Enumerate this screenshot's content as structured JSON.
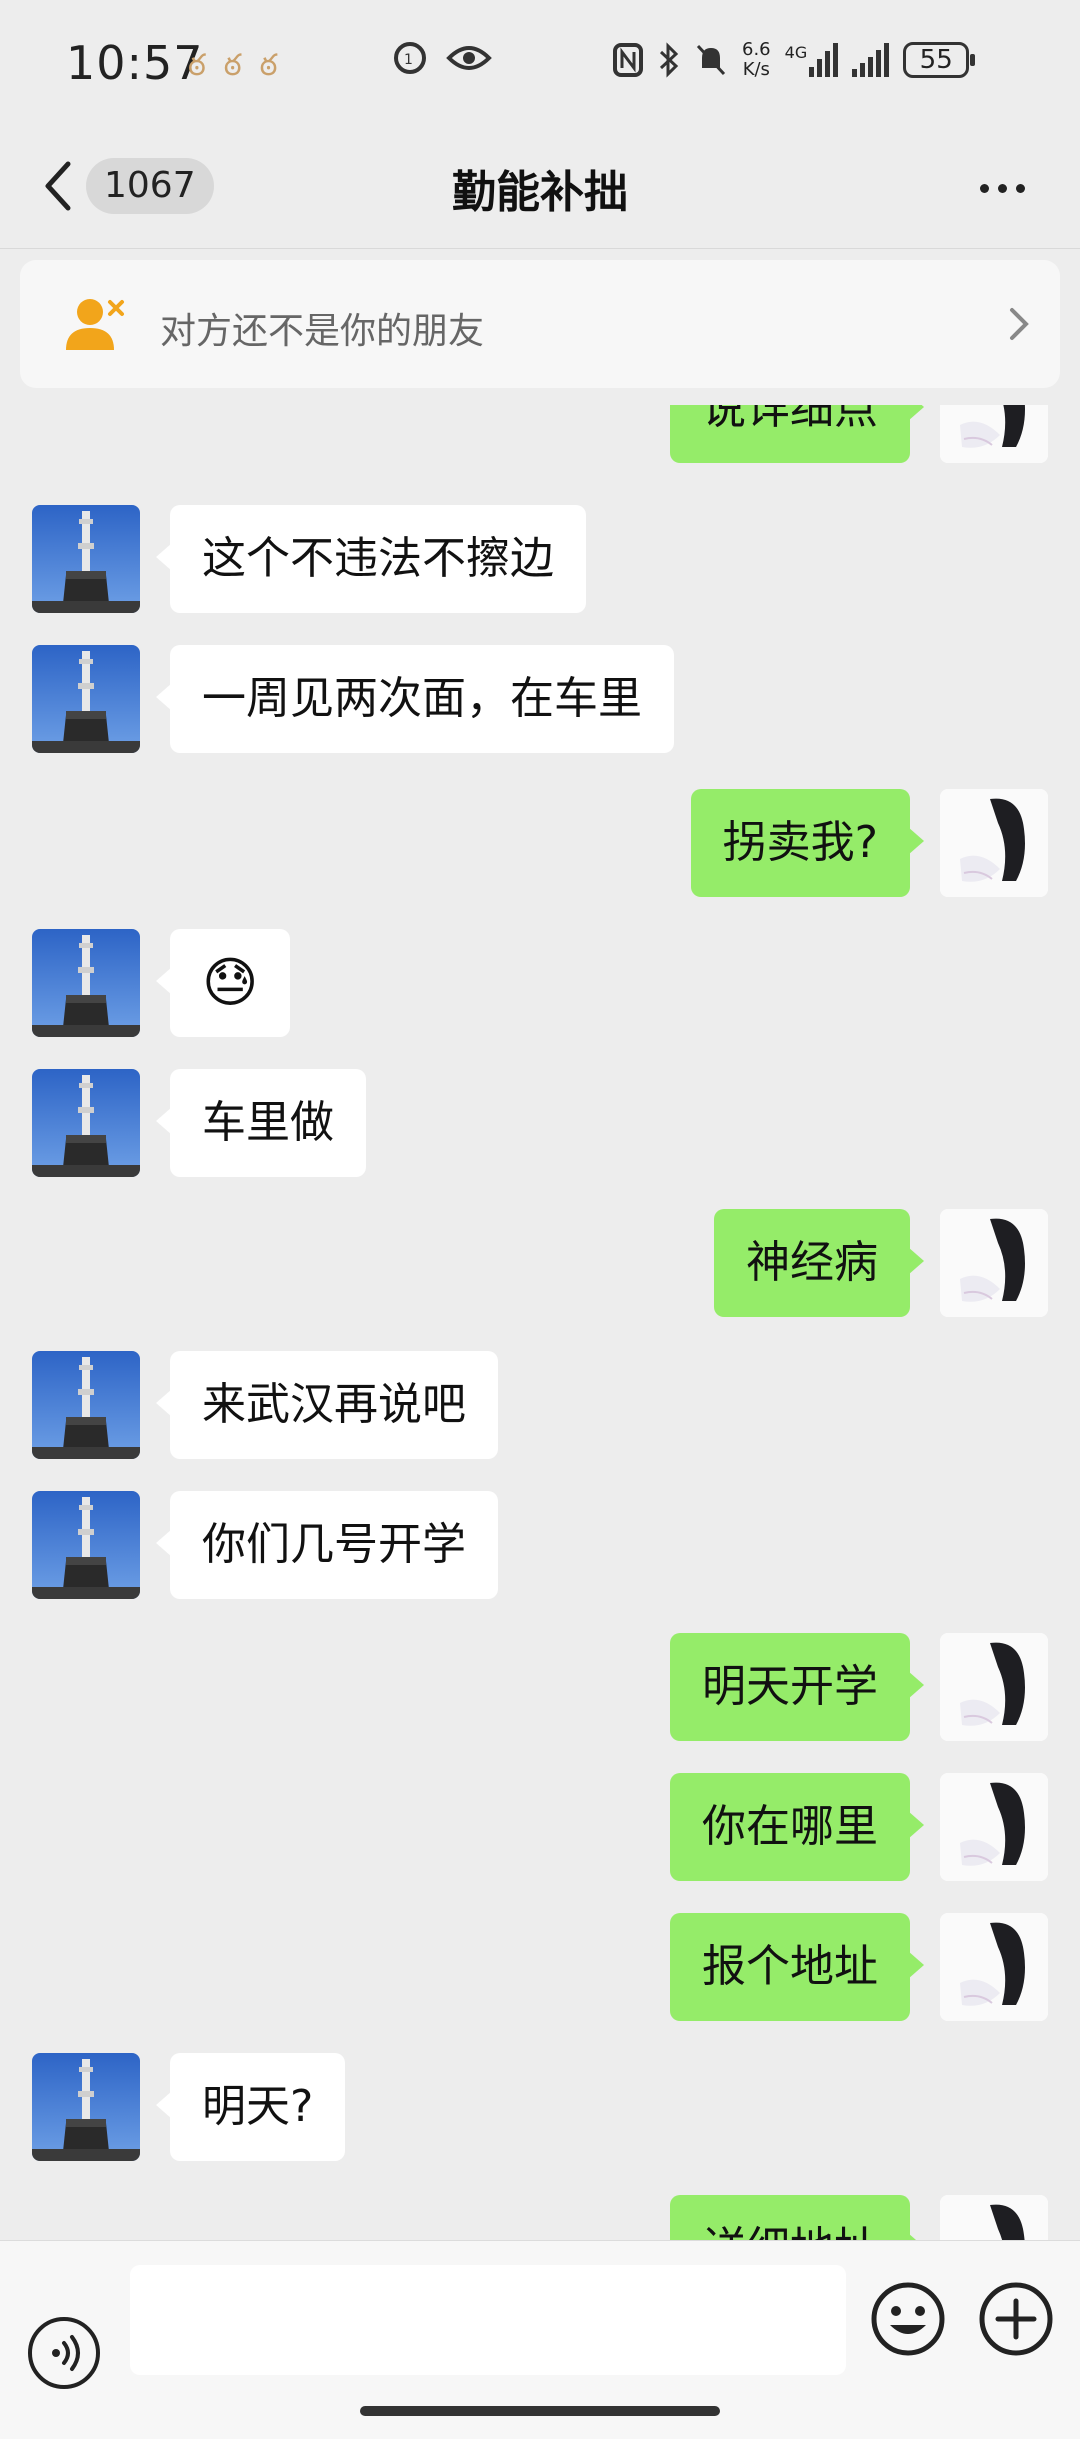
{
  "status_bar": {
    "time": "10:57",
    "network_speed": "6.6",
    "network_speed_unit": "K/s",
    "network_type": "4G",
    "battery": "55"
  },
  "header": {
    "unread_count": "1067",
    "title": "勤能补拙"
  },
  "banner": {
    "text": "对方还不是你的朋友"
  },
  "messages": [
    {
      "side": "out",
      "text": "说详细点"
    },
    {
      "side": "in",
      "text": "这个不违法不擦边"
    },
    {
      "side": "in",
      "text": "一周见两次面，在车里"
    },
    {
      "side": "out",
      "text": "拐卖我?"
    },
    {
      "side": "in",
      "text": "😓",
      "emoji": true
    },
    {
      "side": "in",
      "text": "车里做"
    },
    {
      "side": "out",
      "text": "神经病"
    },
    {
      "side": "in",
      "text": "来武汉再说吧"
    },
    {
      "side": "in",
      "text": "你们几号开学"
    },
    {
      "side": "out",
      "text": "明天开学"
    },
    {
      "side": "out",
      "text": "你在哪里"
    },
    {
      "side": "out",
      "text": "报个地址"
    },
    {
      "side": "in",
      "text": "明天?"
    },
    {
      "side": "out",
      "text": "详细地址"
    }
  ],
  "colors": {
    "background": "#ededed",
    "incoming_bubble": "#ffffff",
    "outgoing_bubble": "#95ec69",
    "banner_icon": "#f2a51b"
  },
  "icons": {
    "back": "chevron-left-icon",
    "more": "more-dots-icon",
    "stranger": "person-add-icon",
    "voice": "voice-icon",
    "emoji": "emoji-icon",
    "plus": "plus-icon"
  }
}
